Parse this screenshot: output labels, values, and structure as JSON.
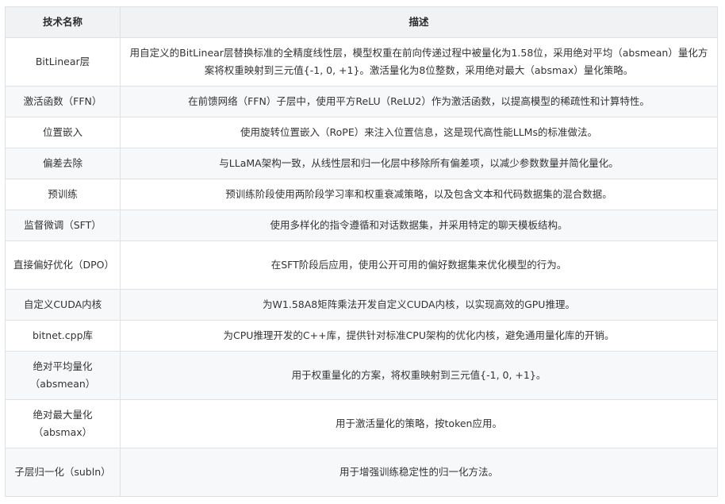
{
  "table": {
    "headers": [
      "技术名称",
      "描述"
    ],
    "rows": [
      {
        "name": "BitLinear层",
        "desc": "用自定义的BitLinear层替换标准的全精度线性层，模型权重在前向传递过程中被量化为1.58位，采用绝对平均（absmean）量化方案将权重映射到三元值{-1, 0, +1}。激活量化为8位整数，采用绝对最大（absmax）量化策略。"
      },
      {
        "name": "激活函数（FFN）",
        "desc": "在前馈网络（FFN）子层中，使用平方ReLU（ReLU2）作为激活函数，以提高模型的稀疏性和计算特性。"
      },
      {
        "name": "位置嵌入",
        "desc": "使用旋转位置嵌入（RoPE）来注入位置信息，这是现代高性能LLMs的标准做法。"
      },
      {
        "name": "偏差去除",
        "desc": "与LLaMA架构一致，从线性层和归一化层中移除所有偏差项，以减少参数数量并简化量化。"
      },
      {
        "name": "预训练",
        "desc": "预训练阶段使用两阶段学习率和权重衰减策略，以及包含文本和代码数据集的混合数据。"
      },
      {
        "name": "监督微调（SFT）",
        "desc": "使用多样化的指令遵循和对话数据集，并采用特定的聊天模板结构。"
      },
      {
        "name": "直接偏好优化（DPO）",
        "desc": "在SFT阶段后应用，使用公开可用的偏好数据集来优化模型的行为。"
      },
      {
        "name": "自定义CUDA内核",
        "desc": "为W1.58A8矩阵乘法开发自定义CUDA内核，以实现高效的GPU推理。"
      },
      {
        "name": "bitnet.cpp库",
        "desc": "为CPU推理开发的C++库，提供针对标准CPU架构的优化内核，避免通用量化库的开销。"
      },
      {
        "name": "绝对平均量化（absmean）",
        "desc": "用于权重量化的方案，将权重映射到三元值{-1, 0, +1}。"
      },
      {
        "name": "绝对最大量化（absmax）",
        "desc": "用于激活量化的策略，按token应用。"
      },
      {
        "name": "子层归一化（subln）",
        "desc": "用于增强训练稳定性的归一化方法。"
      }
    ]
  }
}
